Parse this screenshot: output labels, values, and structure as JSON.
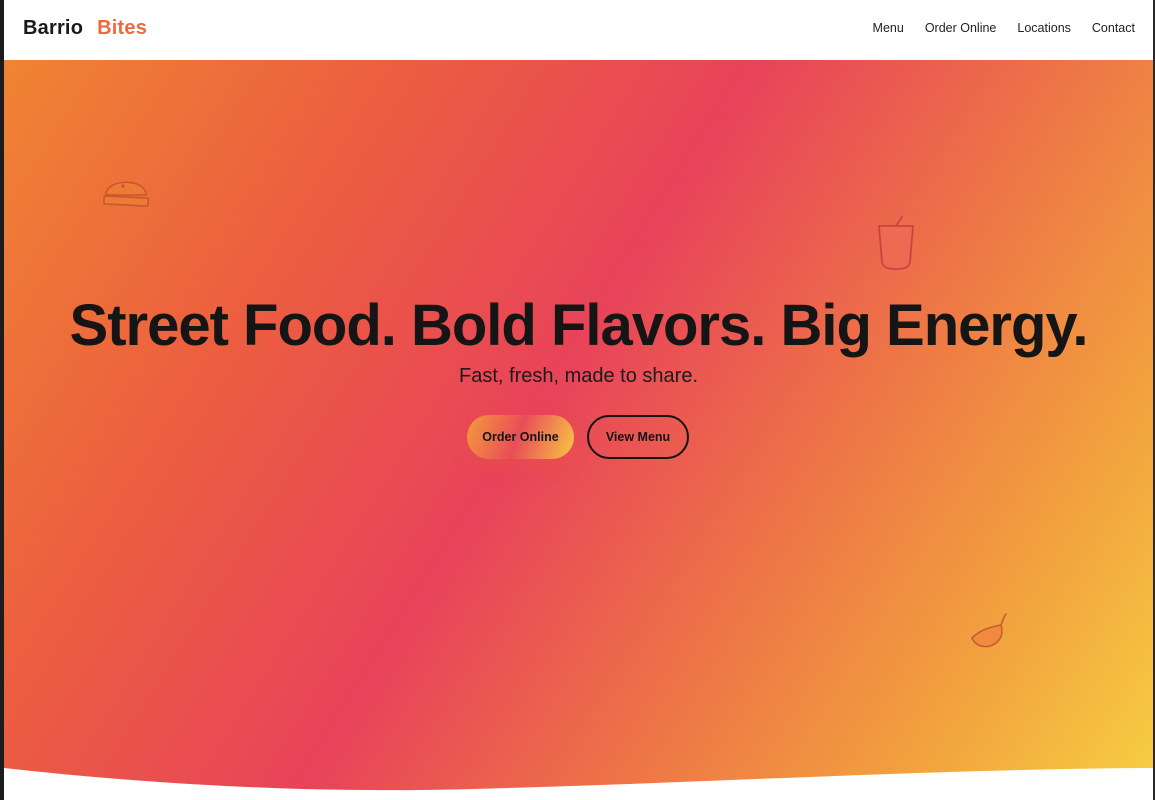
{
  "brand": {
    "name_part1": "Barrio",
    "name_part2": "Bites"
  },
  "nav": {
    "items": [
      "Menu",
      "Order Online",
      "Locations",
      "Contact"
    ]
  },
  "hero": {
    "headline": "Street Food. Bold Flavors. Big Energy.",
    "subheadline": "Fast, fresh, made to share.",
    "primary_cta": "Order Online",
    "secondary_cta": "View Menu"
  },
  "decorations": {
    "icons": [
      "burger-icon",
      "drink-cup-icon",
      "chili-pepper-icon"
    ]
  },
  "colors": {
    "brand_accent": "#ee6a3c",
    "gradient": [
      "#f08433",
      "#ec5f3f",
      "#e8435a",
      "#ee7646",
      "#f2a23e",
      "#f7d042"
    ],
    "text_dark": "#151515"
  }
}
